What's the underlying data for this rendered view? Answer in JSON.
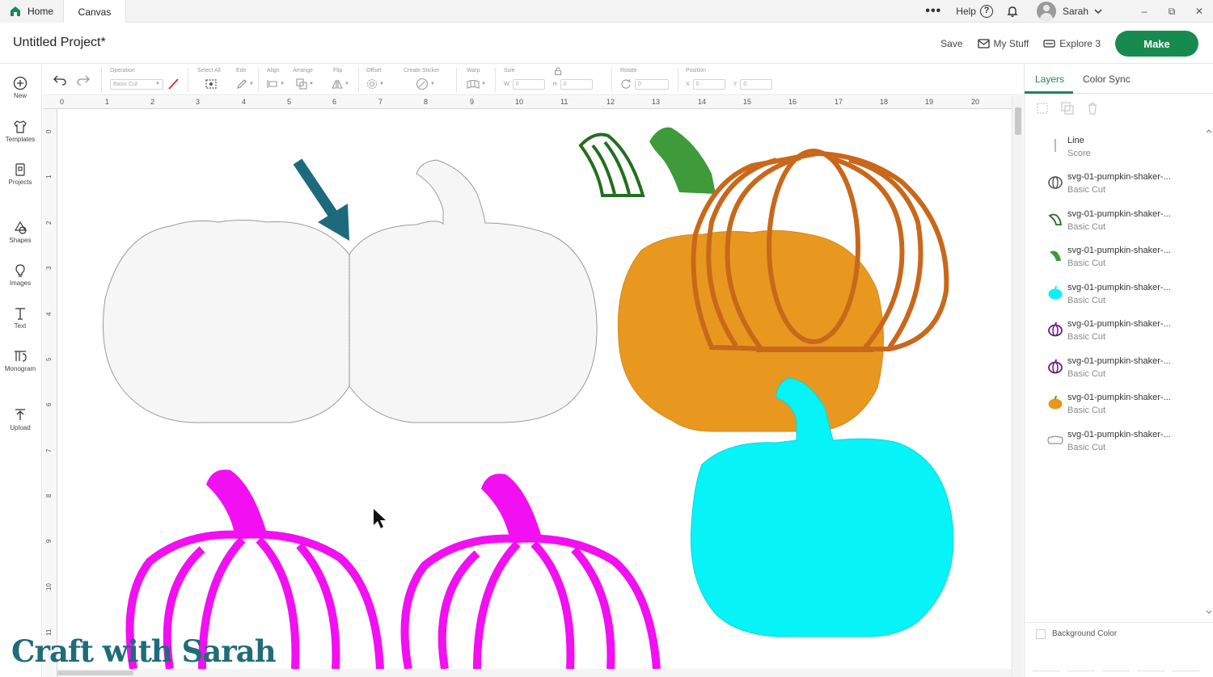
{
  "tabs": {
    "home": "Home",
    "canvas": "Canvas"
  },
  "topbar": {
    "more": "•••",
    "help": "Help",
    "help_icon": "?",
    "user": "Sarah"
  },
  "header": {
    "title": "Untitled Project*",
    "save": "Save",
    "my_stuff": "My Stuff",
    "machine": "Explore 3",
    "make": "Make"
  },
  "leftbar": {
    "items": [
      "New",
      "Templates",
      "Projects",
      "Shapes",
      "Images",
      "Text",
      "Monogram",
      "Upload"
    ]
  },
  "toolbar": {
    "operation_label": "Operation",
    "operation_value": "Basic Cut",
    "select_all": "Select All",
    "edit": "Edit",
    "align": "Align",
    "arrange": "Arrange",
    "flip": "Flip",
    "offset": "Offset",
    "create_sticker": "Create Sticker",
    "warp": "Warp",
    "size": "Size",
    "w_label": "W",
    "w_value": "0",
    "h_label": "H",
    "h_value": "0",
    "rotate": "Rotate",
    "rotate_value": "0",
    "position": "Position",
    "x_label": "X",
    "x_value": "0",
    "y_label": "Y",
    "y_value": "0"
  },
  "ruler": {
    "horizontal": [
      "0",
      "1",
      "2",
      "3",
      "4",
      "5",
      "6",
      "7",
      "8",
      "9",
      "10",
      "11",
      "12",
      "13",
      "14",
      "15",
      "16",
      "17",
      "18",
      "19",
      "20"
    ],
    "vertical": [
      "0",
      "1",
      "2",
      "3",
      "4",
      "5",
      "6",
      "7",
      "8",
      "9",
      "10",
      "11"
    ]
  },
  "colors": {
    "make_green": "#178b4f",
    "pumpkin_orange": "#e8981f",
    "rib_orange": "#c9681a",
    "stem_green": "#3f9a3a",
    "stem_dark_green": "#236e1f",
    "cyan": "#06f3f8",
    "magenta": "#f20ff2",
    "arrow_teal": "#1d6a7d"
  },
  "watermark": "Craft with Sarah",
  "panel": {
    "tab_layers": "Layers",
    "tab_color_sync": "Color Sync",
    "layers": [
      {
        "name": "Line",
        "op": "Score",
        "icon": "line-icon"
      },
      {
        "name": "svg-01-pumpkin-shaker-...",
        "op": "Basic Cut",
        "icon": "pumpkin-ribs-icon"
      },
      {
        "name": "svg-01-pumpkin-shaker-...",
        "op": "Basic Cut",
        "icon": "stem-outline-icon"
      },
      {
        "name": "svg-01-pumpkin-shaker-...",
        "op": "Basic Cut",
        "icon": "stem-icon"
      },
      {
        "name": "svg-01-pumpkin-shaker-...",
        "op": "Basic Cut",
        "icon": "pumpkin-cyan-icon"
      },
      {
        "name": "svg-01-pumpkin-shaker-...",
        "op": "Basic Cut",
        "icon": "pumpkin-purple-icon"
      },
      {
        "name": "svg-01-pumpkin-shaker-...",
        "op": "Basic Cut",
        "icon": "pumpkin-purple-icon"
      },
      {
        "name": "svg-01-pumpkin-shaker-...",
        "op": "Basic Cut",
        "icon": "pumpkin-orange-icon"
      },
      {
        "name": "svg-01-pumpkin-shaker-...",
        "op": "Basic Cut",
        "icon": "pumpkin-outline-icon"
      }
    ],
    "background_color": "Background Color"
  }
}
